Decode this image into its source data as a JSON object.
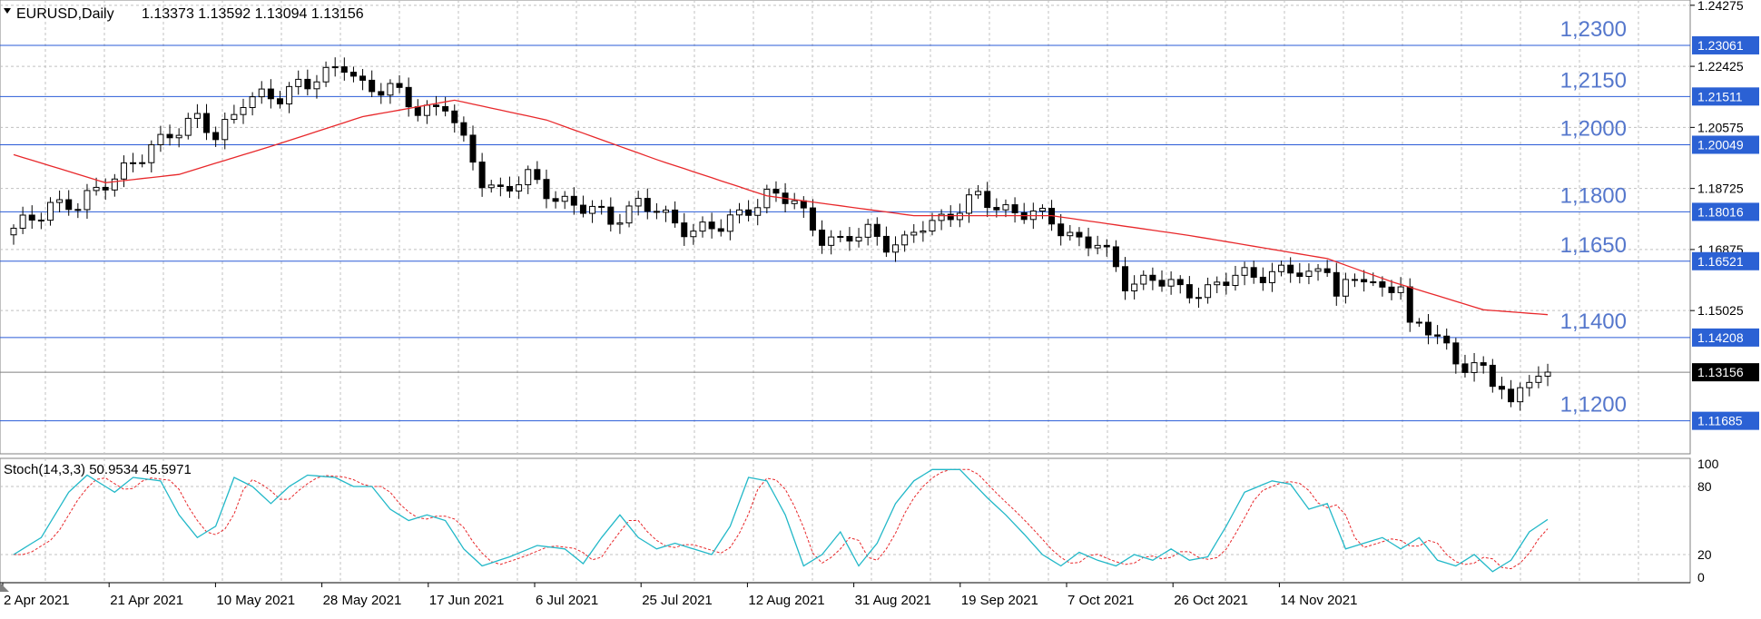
{
  "header": {
    "symbol": "EURUSD,Daily",
    "ohlc": "1.13373 1.13592 1.13094 1.13156"
  },
  "stoch_header": {
    "label": "Stoch(14,3,3) 50.9534 45.5971"
  },
  "colors": {
    "bull_fill": "#ffffff",
    "bear_fill": "#000000",
    "candle_outline": "#000000",
    "ma_line": "#e8282b",
    "level_line": "#2a5bd7",
    "level_text": "#5577cc",
    "level_tag_bg": "#2b61d4",
    "current_tag_bg": "#000000",
    "grid": "#c0c0c0",
    "stoch_main": "#22b8c8",
    "stoch_signal": "#e8282b"
  },
  "price_axis": {
    "ticks": [
      "1.24275",
      "1.22425",
      "1.20575",
      "1.18725",
      "1.16875",
      "1.15025"
    ]
  },
  "levels": [
    {
      "value": 1.23061,
      "tag": "1.23061",
      "label": "1,2300"
    },
    {
      "value": 1.21511,
      "tag": "1.21511",
      "label": "1,2150"
    },
    {
      "value": 1.20049,
      "tag": "1.20049",
      "label": "1,2000"
    },
    {
      "value": 1.18016,
      "tag": "1.18016",
      "label": "1,1800"
    },
    {
      "value": 1.16521,
      "tag": "1.16521",
      "label": "1,1650"
    },
    {
      "value": 1.14208,
      "tag": "1.14208",
      "label": "1,1400"
    },
    {
      "value": 1.11685,
      "tag": "1.11685",
      "label": "1,1200"
    }
  ],
  "current_price": {
    "value": 1.13156,
    "tag": "1.13156"
  },
  "stoch_axis": {
    "ticks": [
      "100",
      "80",
      "20",
      "0"
    ]
  },
  "date_labels": [
    "2 Apr 2021",
    "21 Apr 2021",
    "10 May 2021",
    "28 May 2021",
    "17 Jun 2021",
    "6 Jul 2021",
    "25 Jul 2021",
    "12 Aug 2021",
    "31 Aug 2021",
    "19 Sep 2021",
    "7 Oct 2021",
    "26 Oct 2021",
    "14 Nov 2021"
  ],
  "chart_data": {
    "type": "candlestick",
    "title": "EURUSD,Daily",
    "price_ylim": [
      1.1085,
      1.2427
    ],
    "stoch_ylim": [
      0,
      100
    ],
    "anchors": [
      {
        "i": 0,
        "close": 1.174
      },
      {
        "i": 4,
        "close": 1.183
      },
      {
        "i": 7,
        "close": 1.181
      },
      {
        "i": 10,
        "close": 1.19
      },
      {
        "i": 14,
        "close": 1.196
      },
      {
        "i": 17,
        "close": 1.205
      },
      {
        "i": 20,
        "close": 1.208
      },
      {
        "i": 22,
        "close": 1.202
      },
      {
        "i": 25,
        "close": 1.215
      },
      {
        "i": 29,
        "close": 1.214
      },
      {
        "i": 31,
        "close": 1.22
      },
      {
        "i": 34,
        "close": 1.221
      },
      {
        "i": 36,
        "close": 1.224
      },
      {
        "i": 38,
        "close": 1.219
      },
      {
        "i": 41,
        "close": 1.217
      },
      {
        "i": 44,
        "close": 1.211
      },
      {
        "i": 47,
        "close": 1.213
      },
      {
        "i": 49,
        "close": 1.2
      },
      {
        "i": 51,
        "close": 1.19
      },
      {
        "i": 53,
        "close": 1.187
      },
      {
        "i": 56,
        "close": 1.19
      },
      {
        "i": 59,
        "close": 1.185
      },
      {
        "i": 62,
        "close": 1.181
      },
      {
        "i": 65,
        "close": 1.178
      },
      {
        "i": 68,
        "close": 1.183
      },
      {
        "i": 71,
        "close": 1.178
      },
      {
        "i": 74,
        "close": 1.175
      },
      {
        "i": 77,
        "close": 1.175
      },
      {
        "i": 80,
        "close": 1.182
      },
      {
        "i": 82,
        "close": 1.185
      },
      {
        "i": 85,
        "close": 1.183
      },
      {
        "i": 88,
        "close": 1.173
      },
      {
        "i": 90,
        "close": 1.17
      },
      {
        "i": 93,
        "close": 1.175
      },
      {
        "i": 95,
        "close": 1.171
      },
      {
        "i": 97,
        "close": 1.17
      },
      {
        "i": 99,
        "close": 1.176
      },
      {
        "i": 102,
        "close": 1.18
      },
      {
        "i": 105,
        "close": 1.184
      },
      {
        "i": 107,
        "close": 1.182
      },
      {
        "i": 110,
        "close": 1.18
      },
      {
        "i": 113,
        "close": 1.177
      },
      {
        "i": 116,
        "close": 1.172
      },
      {
        "i": 118,
        "close": 1.17
      },
      {
        "i": 121,
        "close": 1.159
      },
      {
        "i": 124,
        "close": 1.16
      },
      {
        "i": 127,
        "close": 1.156
      },
      {
        "i": 130,
        "close": 1.157
      },
      {
        "i": 133,
        "close": 1.16
      },
      {
        "i": 136,
        "close": 1.162
      },
      {
        "i": 139,
        "close": 1.162
      },
      {
        "i": 141,
        "close": 1.16
      },
      {
        "i": 143,
        "close": 1.165
      },
      {
        "i": 144,
        "close": 1.156
      },
      {
        "i": 147,
        "close": 1.16
      },
      {
        "i": 149,
        "close": 1.156
      },
      {
        "i": 151,
        "close": 1.16
      },
      {
        "i": 152,
        "close": 1.145
      },
      {
        "i": 155,
        "close": 1.143
      },
      {
        "i": 157,
        "close": 1.135
      },
      {
        "i": 159,
        "close": 1.134
      },
      {
        "i": 161,
        "close": 1.127
      },
      {
        "i": 162,
        "close": 1.128
      },
      {
        "i": 163,
        "close": 1.122
      },
      {
        "i": 165,
        "close": 1.131
      },
      {
        "i": 167,
        "close": 1.1316
      }
    ],
    "ma_anchors": [
      {
        "i": 0,
        "value": 1.1975
      },
      {
        "i": 10,
        "value": 1.189
      },
      {
        "i": 18,
        "value": 1.1915
      },
      {
        "i": 28,
        "value": 1.2
      },
      {
        "i": 38,
        "value": 1.209
      },
      {
        "i": 48,
        "value": 1.214
      },
      {
        "i": 58,
        "value": 1.208
      },
      {
        "i": 70,
        "value": 1.196
      },
      {
        "i": 82,
        "value": 1.185
      },
      {
        "i": 98,
        "value": 1.179
      },
      {
        "i": 113,
        "value": 1.179
      },
      {
        "i": 128,
        "value": 1.173
      },
      {
        "i": 143,
        "value": 1.166
      },
      {
        "i": 150,
        "value": 1.159
      },
      {
        "i": 160,
        "value": 1.1505
      },
      {
        "i": 167,
        "value": 1.149
      }
    ],
    "stoch_main": [
      {
        "i": 0,
        "v": 20
      },
      {
        "i": 3,
        "v": 35
      },
      {
        "i": 6,
        "v": 75
      },
      {
        "i": 8,
        "v": 90
      },
      {
        "i": 11,
        "v": 75
      },
      {
        "i": 13,
        "v": 88
      },
      {
        "i": 16,
        "v": 85
      },
      {
        "i": 18,
        "v": 55
      },
      {
        "i": 20,
        "v": 35
      },
      {
        "i": 22,
        "v": 45
      },
      {
        "i": 24,
        "v": 88
      },
      {
        "i": 26,
        "v": 80
      },
      {
        "i": 28,
        "v": 65
      },
      {
        "i": 30,
        "v": 80
      },
      {
        "i": 32,
        "v": 90
      },
      {
        "i": 35,
        "v": 88
      },
      {
        "i": 37,
        "v": 80
      },
      {
        "i": 39,
        "v": 80
      },
      {
        "i": 41,
        "v": 60
      },
      {
        "i": 43,
        "v": 50
      },
      {
        "i": 45,
        "v": 55
      },
      {
        "i": 47,
        "v": 50
      },
      {
        "i": 49,
        "v": 25
      },
      {
        "i": 51,
        "v": 10
      },
      {
        "i": 54,
        "v": 18
      },
      {
        "i": 57,
        "v": 28
      },
      {
        "i": 60,
        "v": 25
      },
      {
        "i": 62,
        "v": 12
      },
      {
        "i": 64,
        "v": 35
      },
      {
        "i": 66,
        "v": 55
      },
      {
        "i": 68,
        "v": 35
      },
      {
        "i": 70,
        "v": 25
      },
      {
        "i": 72,
        "v": 30
      },
      {
        "i": 74,
        "v": 25
      },
      {
        "i": 76,
        "v": 20
      },
      {
        "i": 78,
        "v": 45
      },
      {
        "i": 80,
        "v": 88
      },
      {
        "i": 82,
        "v": 85
      },
      {
        "i": 84,
        "v": 55
      },
      {
        "i": 86,
        "v": 10
      },
      {
        "i": 88,
        "v": 20
      },
      {
        "i": 90,
        "v": 40
      },
      {
        "i": 92,
        "v": 10
      },
      {
        "i": 94,
        "v": 30
      },
      {
        "i": 96,
        "v": 65
      },
      {
        "i": 98,
        "v": 85
      },
      {
        "i": 100,
        "v": 95
      },
      {
        "i": 103,
        "v": 95
      },
      {
        "i": 106,
        "v": 70
      },
      {
        "i": 108,
        "v": 55
      },
      {
        "i": 110,
        "v": 38
      },
      {
        "i": 112,
        "v": 20
      },
      {
        "i": 114,
        "v": 10
      },
      {
        "i": 116,
        "v": 22
      },
      {
        "i": 118,
        "v": 15
      },
      {
        "i": 120,
        "v": 10
      },
      {
        "i": 122,
        "v": 20
      },
      {
        "i": 124,
        "v": 15
      },
      {
        "i": 126,
        "v": 25
      },
      {
        "i": 128,
        "v": 15
      },
      {
        "i": 130,
        "v": 18
      },
      {
        "i": 132,
        "v": 45
      },
      {
        "i": 134,
        "v": 75
      },
      {
        "i": 137,
        "v": 85
      },
      {
        "i": 139,
        "v": 82
      },
      {
        "i": 141,
        "v": 60
      },
      {
        "i": 143,
        "v": 65
      },
      {
        "i": 145,
        "v": 25
      },
      {
        "i": 147,
        "v": 30
      },
      {
        "i": 149,
        "v": 35
      },
      {
        "i": 151,
        "v": 25
      },
      {
        "i": 153,
        "v": 35
      },
      {
        "i": 155,
        "v": 15
      },
      {
        "i": 157,
        "v": 10
      },
      {
        "i": 159,
        "v": 20
      },
      {
        "i": 161,
        "v": 5
      },
      {
        "i": 163,
        "v": 15
      },
      {
        "i": 165,
        "v": 40
      },
      {
        "i": 167,
        "v": 51
      }
    ],
    "stoch_signal_lag": 1.5
  }
}
